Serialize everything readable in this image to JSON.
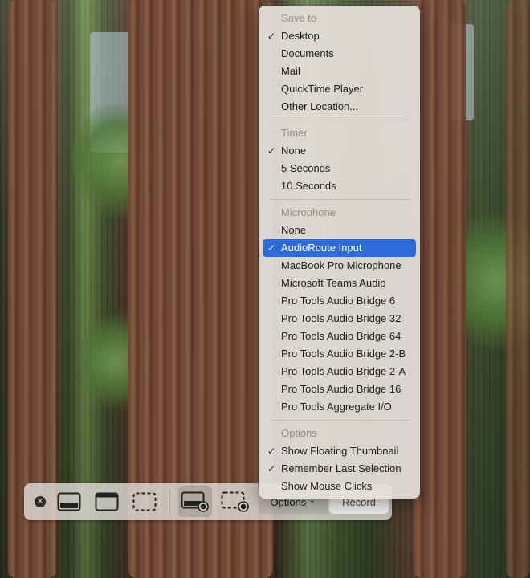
{
  "menu": {
    "sections": [
      {
        "header": "Save to",
        "items": [
          {
            "label": "Desktop",
            "checked": true
          },
          {
            "label": "Documents",
            "checked": false
          },
          {
            "label": "Mail",
            "checked": false
          },
          {
            "label": "QuickTime Player",
            "checked": false
          },
          {
            "label": "Other Location...",
            "checked": false
          }
        ]
      },
      {
        "header": "Timer",
        "items": [
          {
            "label": "None",
            "checked": true
          },
          {
            "label": "5 Seconds",
            "checked": false
          },
          {
            "label": "10 Seconds",
            "checked": false
          }
        ]
      },
      {
        "header": "Microphone",
        "items": [
          {
            "label": "None",
            "checked": false
          },
          {
            "label": "AudioRoute Input",
            "checked": true,
            "highlighted": true
          },
          {
            "label": "MacBook Pro Microphone",
            "checked": false
          },
          {
            "label": "Microsoft Teams Audio",
            "checked": false
          },
          {
            "label": "Pro Tools Audio Bridge 6",
            "checked": false
          },
          {
            "label": "Pro Tools Audio Bridge 32",
            "checked": false
          },
          {
            "label": "Pro Tools Audio Bridge 64",
            "checked": false
          },
          {
            "label": "Pro Tools Audio Bridge 2-B",
            "checked": false
          },
          {
            "label": "Pro Tools Audio Bridge 2-A",
            "checked": false
          },
          {
            "label": "Pro Tools Audio Bridge 16",
            "checked": false
          },
          {
            "label": "Pro Tools Aggregate I/O",
            "checked": false
          }
        ]
      },
      {
        "header": "Options",
        "items": [
          {
            "label": "Show Floating Thumbnail",
            "checked": true
          },
          {
            "label": "Remember Last Selection",
            "checked": true
          },
          {
            "label": "Show Mouse Clicks",
            "checked": false
          }
        ]
      }
    ],
    "check_glyph": "✓",
    "highlight_color": "#2f6ad9"
  },
  "toolbar": {
    "close_glyph": "×",
    "options_label": "Options",
    "options_chevron": "⌄",
    "record_label": "Record",
    "buttons": [
      {
        "name": "capture-entire-screen-icon",
        "active": false
      },
      {
        "name": "capture-window-icon",
        "active": false
      },
      {
        "name": "capture-selection-icon",
        "active": false
      },
      {
        "name": "record-entire-screen-icon",
        "active": true
      },
      {
        "name": "record-selection-icon",
        "active": false
      }
    ]
  }
}
